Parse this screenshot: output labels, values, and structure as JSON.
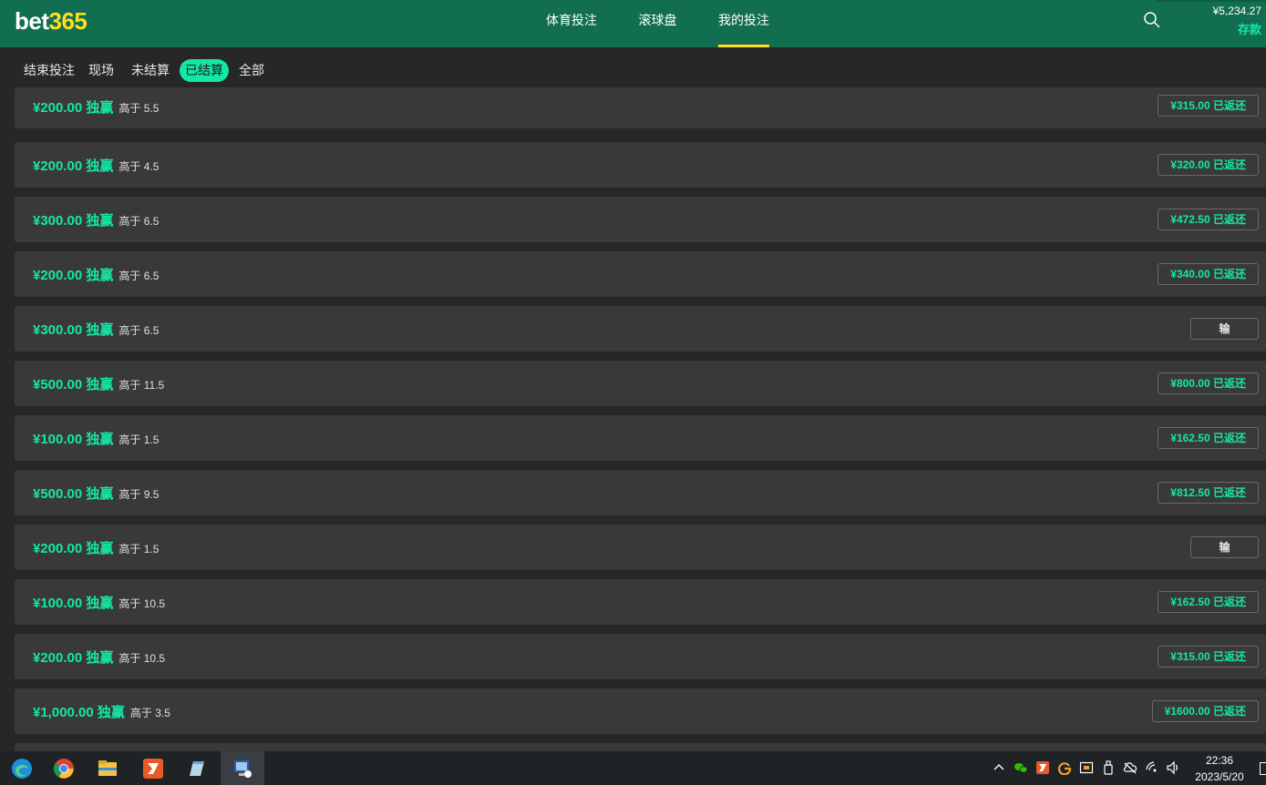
{
  "header": {
    "logo_bet": "bet",
    "logo_num": "365",
    "nav": [
      {
        "label": "体育投注"
      },
      {
        "label": "滚球盘"
      },
      {
        "label": "我的投注"
      }
    ],
    "balance": "¥5,234.27",
    "deposit_label": "存款",
    "accent_color": "#ffdf1b",
    "brand_color": "#126e51"
  },
  "subnav": {
    "tabs": [
      {
        "label": "结束投注"
      },
      {
        "label": "现场"
      },
      {
        "label": "未结算"
      },
      {
        "label": "已结算"
      },
      {
        "label": "全部"
      }
    ],
    "active_tab": "已结算"
  },
  "bets": [
    {
      "stake": "¥200.00 独赢",
      "selection": "高于 5.5",
      "status": "¥315.00  已返还",
      "type": "returned"
    },
    {
      "stake": "¥200.00 独赢",
      "selection": "高于 4.5",
      "status": "¥320.00  已返还",
      "type": "returned"
    },
    {
      "stake": "¥300.00 独赢",
      "selection": "高于 6.5",
      "status": "¥472.50  已返还",
      "type": "returned"
    },
    {
      "stake": "¥200.00 独赢",
      "selection": "高于 6.5",
      "status": "¥340.00  已返还",
      "type": "returned"
    },
    {
      "stake": "¥300.00 独赢",
      "selection": "高于 6.5",
      "status": "输",
      "type": "lost"
    },
    {
      "stake": "¥500.00 独赢",
      "selection": "高于 11.5",
      "status": "¥800.00  已返还",
      "type": "returned"
    },
    {
      "stake": "¥100.00 独赢",
      "selection": "高于 1.5",
      "status": "¥162.50  已返还",
      "type": "returned"
    },
    {
      "stake": "¥500.00 独赢",
      "selection": "高于 9.5",
      "status": "¥812.50  已返还",
      "type": "returned"
    },
    {
      "stake": "¥200.00 独赢",
      "selection": "高于 1.5",
      "status": "输",
      "type": "lost"
    },
    {
      "stake": "¥100.00 独赢",
      "selection": "高于 10.5",
      "status": "¥162.50  已返还",
      "type": "returned"
    },
    {
      "stake": "¥200.00 独赢",
      "selection": "高于 10.5",
      "status": "¥315.00  已返还",
      "type": "returned"
    },
    {
      "stake": "¥1,000.00 独赢",
      "selection": "高于 3.5",
      "status": "¥1600.00  已返还",
      "type": "returned"
    }
  ],
  "taskbar": {
    "apps": [
      {
        "icon": "edge-icon"
      },
      {
        "icon": "chrome-icon"
      },
      {
        "icon": "file-explorer-icon"
      },
      {
        "icon": "red-app-icon"
      },
      {
        "icon": "notepad-icon"
      },
      {
        "icon": "remote-desktop-icon"
      }
    ],
    "time": "22:36",
    "date": "2023/5/20"
  }
}
